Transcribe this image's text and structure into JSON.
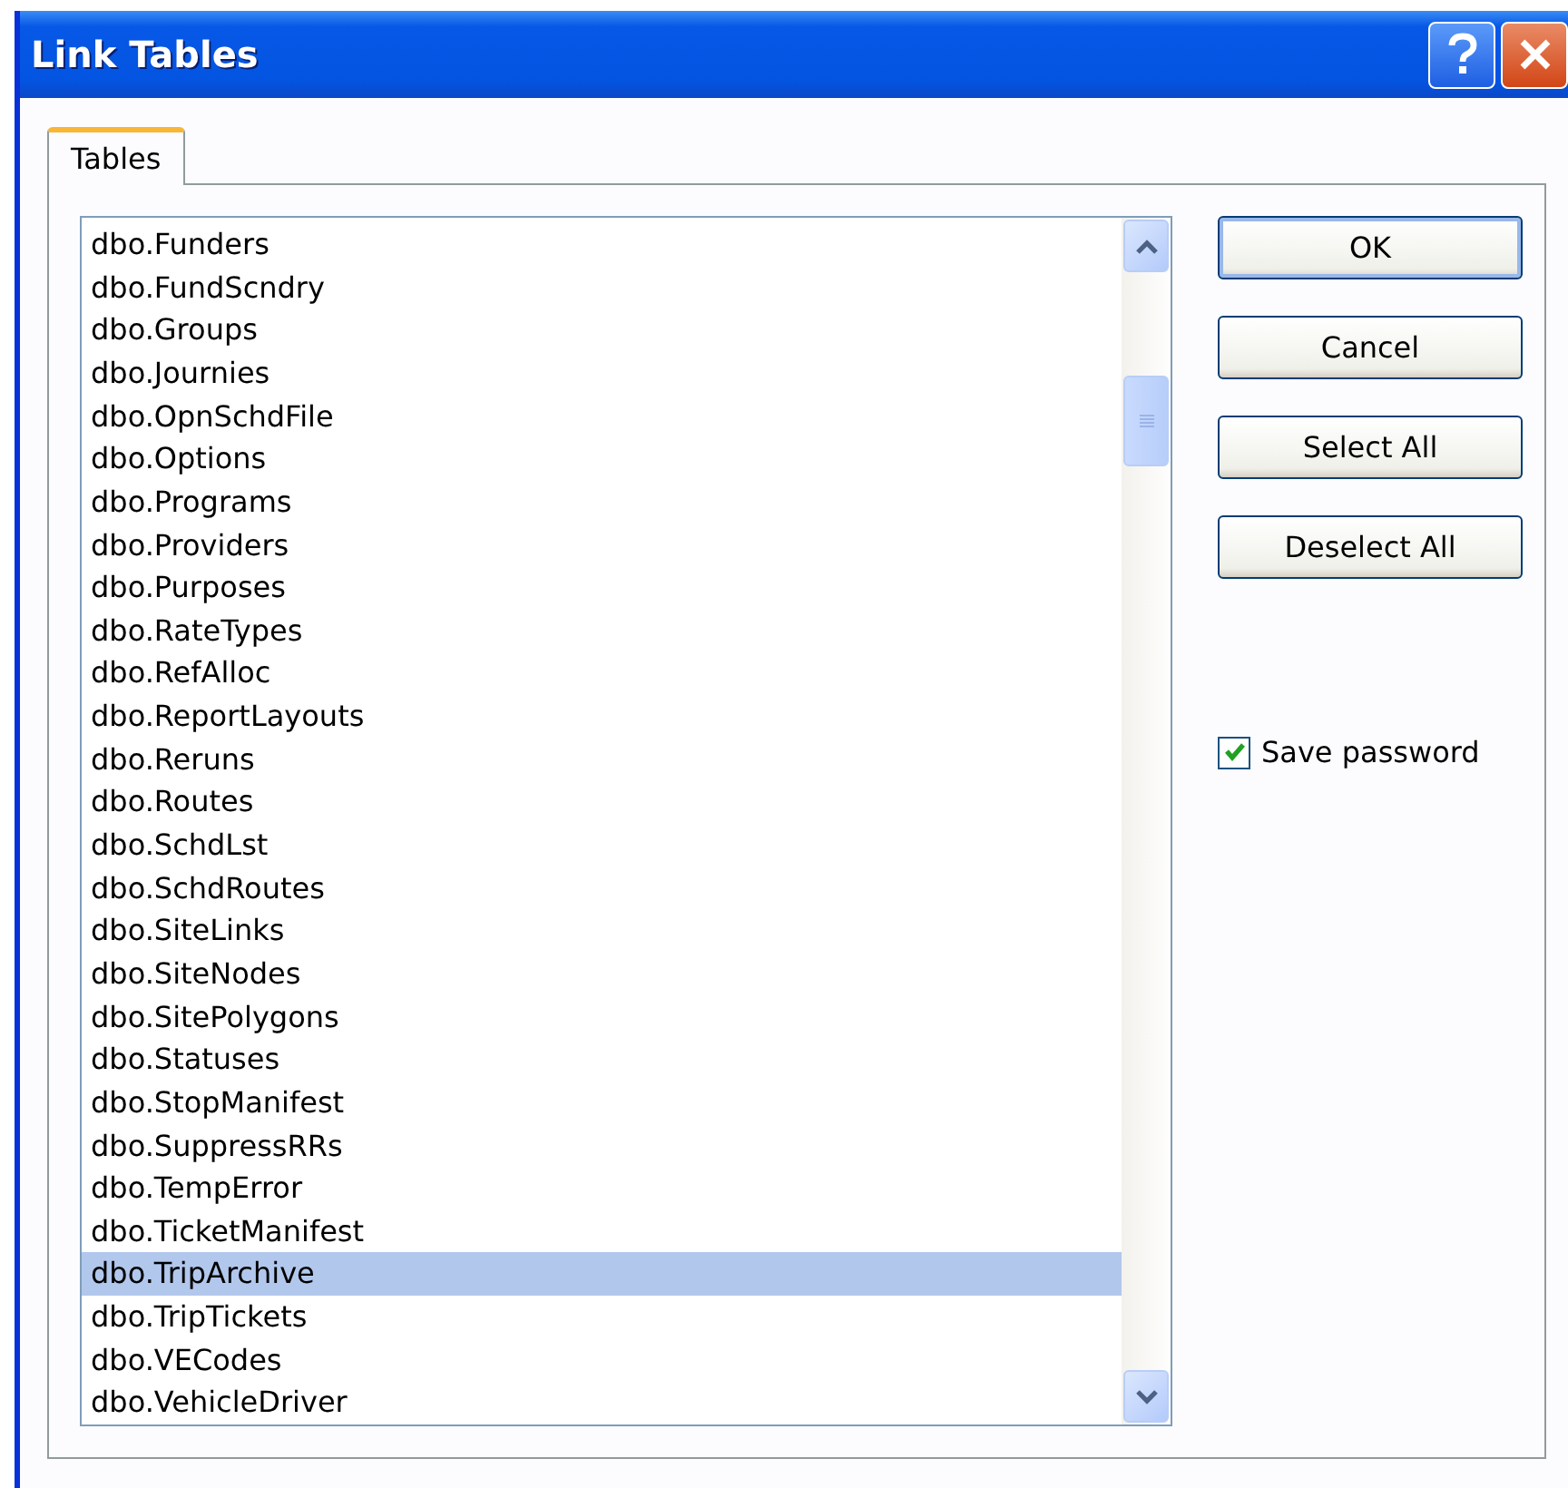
{
  "window": {
    "title": "Link Tables"
  },
  "tabs": [
    {
      "label": "Tables",
      "selected": true
    }
  ],
  "tables": [
    {
      "name": "dbo.Funders",
      "selected": false
    },
    {
      "name": "dbo.FundScndry",
      "selected": false
    },
    {
      "name": "dbo.Groups",
      "selected": false
    },
    {
      "name": "dbo.Journies",
      "selected": false
    },
    {
      "name": "dbo.OpnSchdFile",
      "selected": false
    },
    {
      "name": "dbo.Options",
      "selected": false
    },
    {
      "name": "dbo.Programs",
      "selected": false
    },
    {
      "name": "dbo.Providers",
      "selected": false
    },
    {
      "name": "dbo.Purposes",
      "selected": false
    },
    {
      "name": "dbo.RateTypes",
      "selected": false
    },
    {
      "name": "dbo.RefAlloc",
      "selected": false
    },
    {
      "name": "dbo.ReportLayouts",
      "selected": false
    },
    {
      "name": "dbo.Reruns",
      "selected": false
    },
    {
      "name": "dbo.Routes",
      "selected": false
    },
    {
      "name": "dbo.SchdLst",
      "selected": false
    },
    {
      "name": "dbo.SchdRoutes",
      "selected": false
    },
    {
      "name": "dbo.SiteLinks",
      "selected": false
    },
    {
      "name": "dbo.SiteNodes",
      "selected": false
    },
    {
      "name": "dbo.SitePolygons",
      "selected": false
    },
    {
      "name": "dbo.Statuses",
      "selected": false
    },
    {
      "name": "dbo.StopManifest",
      "selected": false
    },
    {
      "name": "dbo.SuppressRRs",
      "selected": false
    },
    {
      "name": "dbo.TempError",
      "selected": false
    },
    {
      "name": "dbo.TicketManifest",
      "selected": false
    },
    {
      "name": "dbo.TripArchive",
      "selected": true
    },
    {
      "name": "dbo.TripTickets",
      "selected": false
    },
    {
      "name": "dbo.VECodes",
      "selected": false
    },
    {
      "name": "dbo.VehicleDriver",
      "selected": false
    }
  ],
  "buttons": [
    {
      "label": "OK",
      "default": true
    },
    {
      "label": "Cancel",
      "default": false
    },
    {
      "label": "Select All",
      "default": false
    },
    {
      "label": "Deselect All",
      "default": false
    }
  ],
  "save_password": {
    "label": "Save password",
    "checked": true
  }
}
